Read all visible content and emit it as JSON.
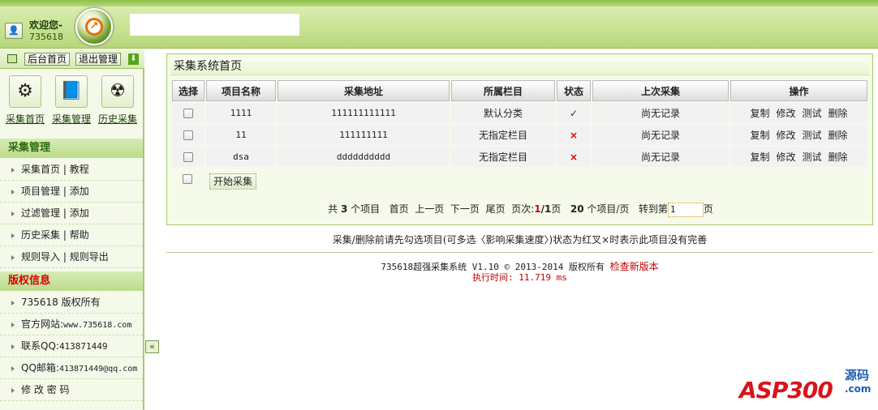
{
  "header": {
    "welcome": "欢迎您-",
    "user": "735618"
  },
  "sidebar": {
    "top_buttons": [
      "后台首页",
      "退出管理"
    ],
    "quick_links": [
      {
        "label": "采集首页",
        "icon": "gears-icon"
      },
      {
        "label": "采集管理",
        "icon": "book-icon"
      },
      {
        "label": "历史采集",
        "icon": "radiation-icon"
      }
    ],
    "section1_title": "采集管理",
    "section1_items": [
      {
        "a": "采集首页",
        "b": "教程"
      },
      {
        "a": "项目管理",
        "b": "添加"
      },
      {
        "a": "过滤管理",
        "b": "添加"
      },
      {
        "a": "历史采集",
        "b": "帮助"
      },
      {
        "a": "规则导入",
        "b": "规则导出"
      }
    ],
    "sep": "|",
    "section2_title": "版权信息",
    "section2_items": [
      {
        "label": "735618 版权所有",
        "value": ""
      },
      {
        "label": "官方网站:",
        "value": "www.735618.com"
      },
      {
        "label": "联系QQ:",
        "value": "413871449"
      },
      {
        "label": "QQ邮箱:",
        "value": "413871449@qq.com"
      },
      {
        "label": "修 改 密 码",
        "value": ""
      }
    ],
    "collapse_glyph": "«"
  },
  "main": {
    "title": "采集系统首页",
    "columns": [
      "选择",
      "项目名称",
      "采集地址",
      "所属栏目",
      "状态",
      "上次采集",
      "操作"
    ],
    "rows": [
      {
        "name": "1111",
        "url": "111111111111",
        "category": "默认分类",
        "status": "✓",
        "last": "尚无记录"
      },
      {
        "name": "11",
        "url": "111111111",
        "category": "无指定栏目",
        "status": "×",
        "last": "尚无记录"
      },
      {
        "name": "dsa",
        "url": "dddddddddd",
        "category": "无指定栏目",
        "status": "×",
        "last": "尚无记录"
      }
    ],
    "ops": [
      "复制",
      "修改",
      "测试",
      "删除"
    ],
    "start_button": "开始采集",
    "pager": {
      "total_prefix": "共",
      "total": "3",
      "total_suffix": "个项目",
      "first": "首页",
      "prev": "上一页",
      "next": "下一页",
      "last": "尾页",
      "page_label": "页次:",
      "current": "1",
      "slash": "/",
      "pages": "1",
      "page_unit": "页",
      "per_page": "20",
      "per_page_suffix": "个项目/页",
      "goto": "转到第",
      "goto_value": "1",
      "goto_suffix": "页"
    },
    "hint": "采集/删除前请先勾选项目(可多选〈影响采集速度〉)状态为红叉×时表示此项目没有完善"
  },
  "footer": {
    "copyright": "735618超强采集系统 V1.10 © 2013-2014 版权所有",
    "update_link": "检查新版本",
    "exec_time": "执行时间: 11.719 ms"
  },
  "watermark": {
    "text": "ASP300",
    "side": "源码",
    "side2": ".com"
  },
  "colors": {
    "accent_green": "#a6cc6b",
    "status_bad": "#e00000",
    "section_red": "#d40000"
  }
}
